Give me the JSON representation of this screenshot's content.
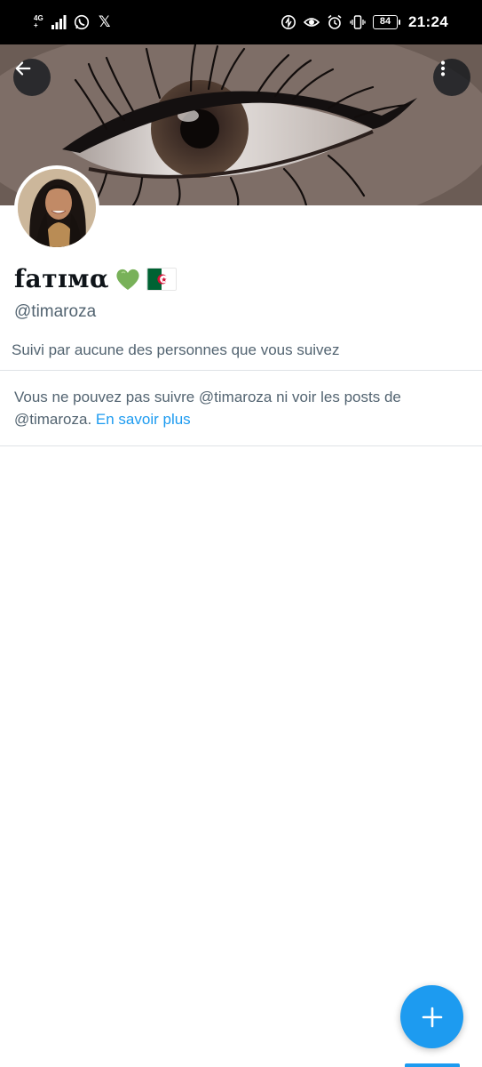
{
  "status_bar": {
    "network_top": "4G",
    "network_bottom": "+",
    "time": "21:24",
    "battery": "84",
    "icons": [
      "signal-icon",
      "whatsapp-icon",
      "x-logo-icon",
      "data-saver-icon",
      "eye-icon",
      "alarm-icon",
      "vibrate-icon",
      "battery-icon"
    ]
  },
  "header": {
    "back_icon": "arrow-left-icon",
    "more_icon": "more-vertical-icon"
  },
  "profile": {
    "display_name": "fатɪмα",
    "name_emojis": [
      "green-heart-icon",
      "algeria-flag-icon"
    ],
    "handle": "@timaroza",
    "followed_by": "Suivi par aucune des personnes que vous suivez"
  },
  "notice": {
    "text": "Vous ne pouvez pas suivre @timaroza ni voir les posts de @timaroza.",
    "link": "En savoir plus"
  },
  "fab": {
    "icon": "plus-icon"
  },
  "colors": {
    "accent": "#1d9bf0",
    "secondary_text": "#536471",
    "primary_text": "#0f1419",
    "divider": "#dfe3e6"
  }
}
